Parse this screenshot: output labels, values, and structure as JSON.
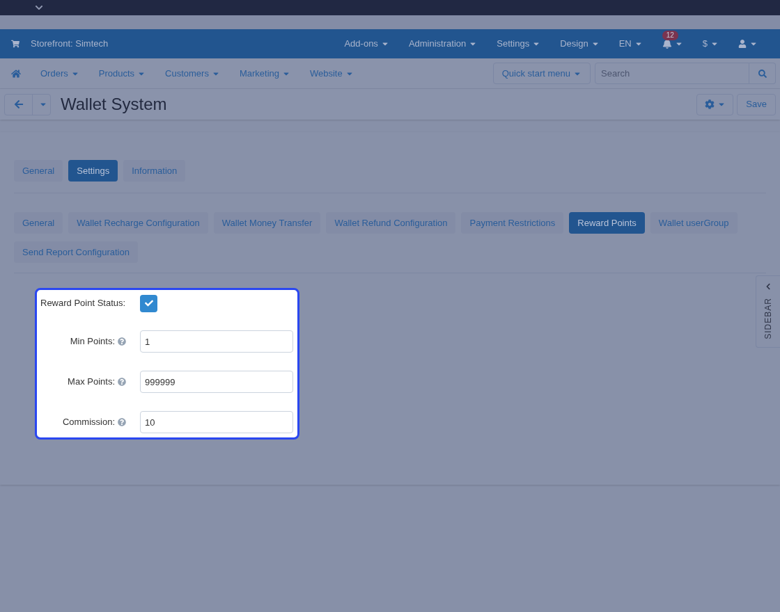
{
  "header": {
    "storefront": "Storefront: Simtech",
    "menus": [
      "Add-ons",
      "Administration",
      "Settings",
      "Design",
      "EN"
    ],
    "notifications_badge": "12",
    "currency": "$"
  },
  "nav": {
    "items": [
      "Orders",
      "Products",
      "Customers",
      "Marketing",
      "Website"
    ],
    "quick_start": "Quick start menu",
    "search": {
      "placeholder": "Search"
    }
  },
  "page": {
    "title": "Wallet System",
    "save": "Save"
  },
  "tabs": [
    {
      "label": "General",
      "selected": false
    },
    {
      "label": "Settings",
      "selected": true
    },
    {
      "label": "Information",
      "selected": false
    }
  ],
  "subtabs": [
    {
      "label": "General",
      "selected": false
    },
    {
      "label": "Wallet Recharge Configuration",
      "selected": false
    },
    {
      "label": "Wallet Money Transfer",
      "selected": false
    },
    {
      "label": "Wallet Refund Configuration",
      "selected": false
    },
    {
      "label": "Payment Restrictions",
      "selected": false
    },
    {
      "label": "Reward Points",
      "selected": true
    },
    {
      "label": "Wallet userGroup",
      "selected": false
    },
    {
      "label": "Send Report Configuration",
      "selected": false
    }
  ],
  "form": [
    {
      "kind": "checkbox",
      "label": "Reward Point Status:",
      "checked": true
    },
    {
      "kind": "input",
      "label": "Min Points:",
      "value": "1",
      "help": true
    },
    {
      "kind": "input",
      "label": "Max Points:",
      "value": "999999",
      "help": true
    },
    {
      "kind": "input",
      "label": "Commission:",
      "value": "10",
      "help": true
    }
  ],
  "sidebar_tab": "SIDEBAR"
}
